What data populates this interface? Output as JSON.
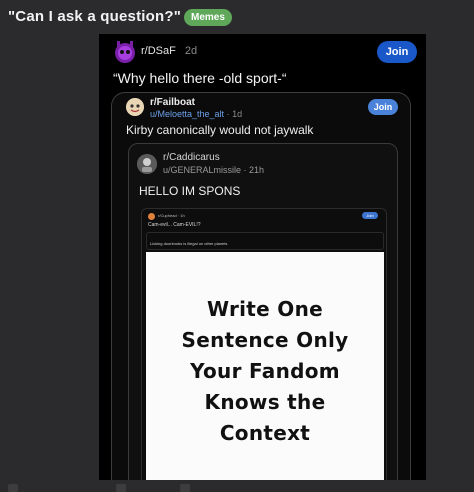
{
  "post": {
    "title": "\"Can I ask a question?\"",
    "flair": "Memes"
  },
  "level1": {
    "subreddit": "r/DSaF",
    "age": "2d",
    "join_label": "Join",
    "text": "“Why hello there -old sport-“"
  },
  "level2": {
    "subreddit": "r/Failboat",
    "user": "u/Meloetta_the_alt",
    "age": "1d",
    "join_label": "Join",
    "text": "Kirby canonically would not jaywalk"
  },
  "level3": {
    "subreddit": "r/Caddicarus",
    "user": "u/GENERALmissile",
    "age": "21h",
    "text": "HELLO IM SPONS"
  },
  "level4": {
    "meta": "r/Cuphead · 1h",
    "join_label": "Join",
    "text": "Cam-evil... Cam-EVIL!?"
  },
  "level5": {
    "text": "Licking doorknobs is illegal on other planets"
  },
  "meme": {
    "lines": [
      "Write One",
      "Sentence Only",
      "Your Fandom",
      "Knows the",
      "Context"
    ]
  },
  "colors": {
    "background": "#2b2b2e",
    "flair": "#5fa85a",
    "join_primary": "#1a57c8",
    "join_secondary": "#4a82d9",
    "user_link": "#6ba0e8"
  }
}
